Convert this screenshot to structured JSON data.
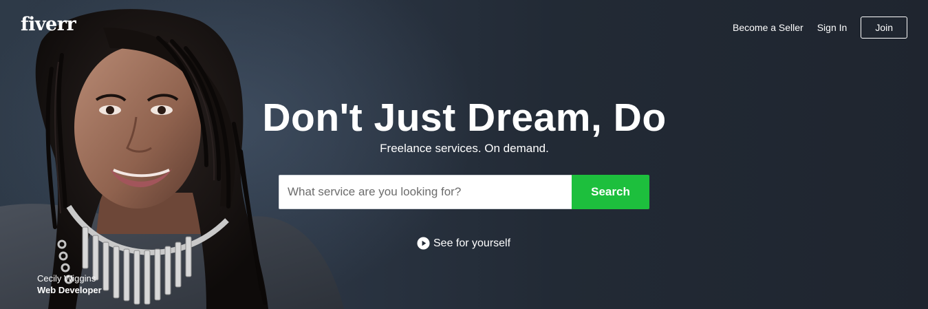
{
  "brand": {
    "logo_text": "fiverr"
  },
  "nav": {
    "become_seller": "Become a Seller",
    "sign_in": "Sign In",
    "join": "Join"
  },
  "hero": {
    "headline": "Don't Just Dream, Do",
    "subheadline": "Freelance services. On demand.",
    "search": {
      "placeholder": "What service are you looking for?",
      "value": "",
      "button_label": "Search"
    },
    "video_link": "See for yourself",
    "person": {
      "name": "Cecily Wiggins",
      "title": "Web Developer"
    }
  },
  "colors": {
    "accent": "#1dbf3d",
    "background": "#222a35",
    "text": "#ffffff"
  },
  "icons": {
    "video_link": "play-circle-icon"
  }
}
